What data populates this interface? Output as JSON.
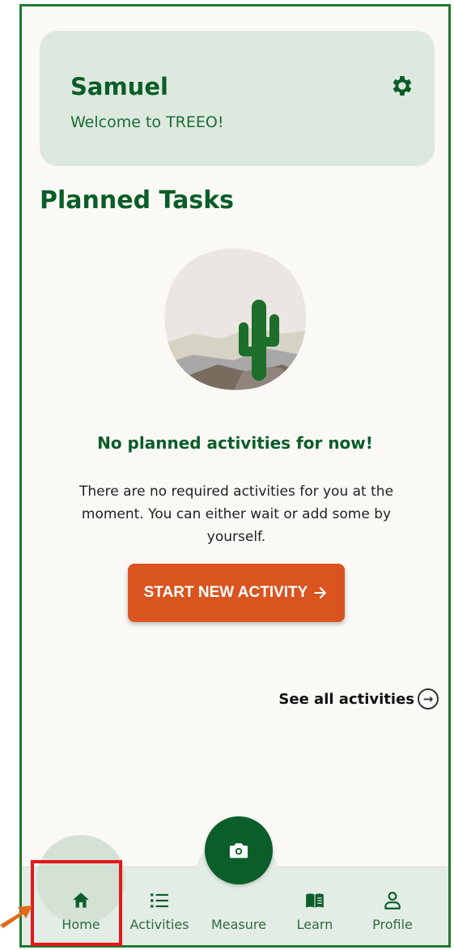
{
  "header": {
    "user_name": "Samuel",
    "welcome_text": "Welcome to TREEO!",
    "settings_icon": "gear-icon"
  },
  "planned_tasks": {
    "title": "Planned Tasks",
    "empty_title": "No planned activities for now!",
    "empty_description": "There are no required activities for you at the moment. You can either wait or add some by yourself.",
    "start_button_label": "START NEW ACTIVITY",
    "start_button_icon": "arrow-right-icon",
    "see_all_label": "See all activities",
    "see_all_icon": "arrow-circle-right-icon"
  },
  "nav": {
    "items": [
      {
        "label": "Home",
        "icon": "home-icon",
        "active": true
      },
      {
        "label": "Activities",
        "icon": "list-icon",
        "active": false
      },
      {
        "label": "Measure",
        "icon": "camera-icon",
        "active": false
      },
      {
        "label": "Learn",
        "icon": "book-icon",
        "active": false
      },
      {
        "label": "Profile",
        "icon": "person-icon",
        "active": false
      }
    ]
  },
  "colors": {
    "primary_green": "#0a5d28",
    "card_bg": "#dde9df",
    "accent_orange": "#d9541f",
    "highlight_red": "#e4161b"
  }
}
